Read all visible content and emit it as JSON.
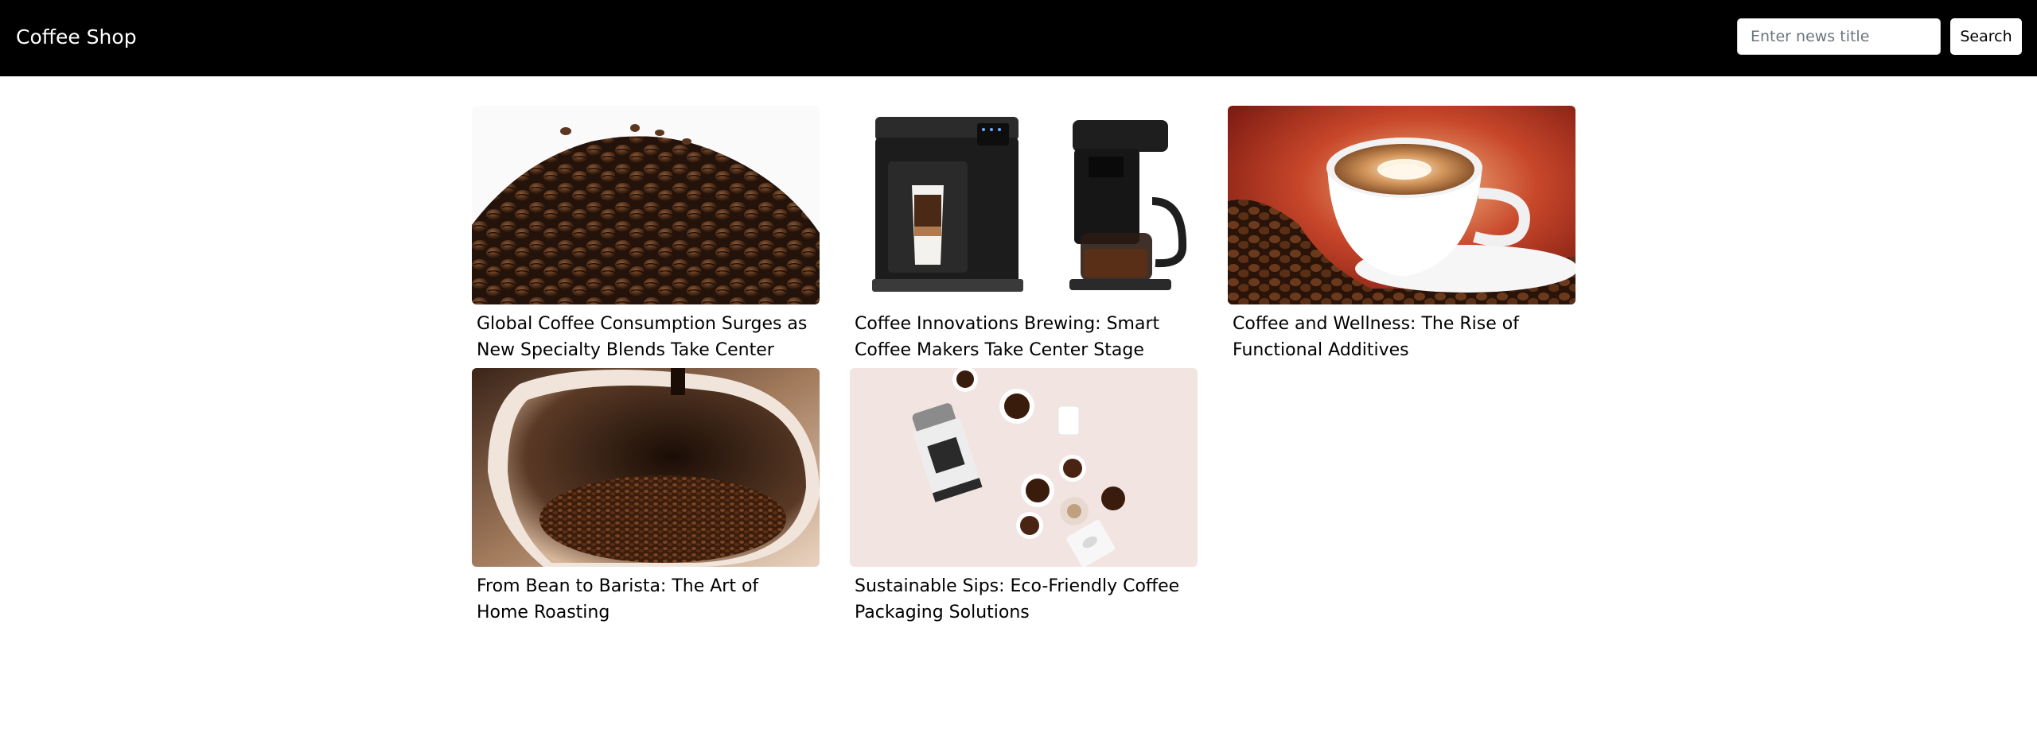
{
  "header": {
    "brand": "Coffee Shop",
    "search_placeholder": "Enter news title",
    "search_label": "Search"
  },
  "articles": [
    {
      "title": "Global Coffee Consumption Surges as New Specialty Blends Take Center Stage",
      "image": "coffee-beans-pile"
    },
    {
      "title": "Coffee Innovations Brewing: Smart Coffee Makers Take Center Stage",
      "image": "coffee-machines"
    },
    {
      "title": "Coffee and Wellness: The Rise of Functional Additives",
      "image": "latte-cup"
    },
    {
      "title": "From Bean to Barista: The Art of Home Roasting",
      "image": "roasting-bowl"
    },
    {
      "title": "Sustainable Sips: Eco-Friendly Coffee Packaging Solutions",
      "image": "eco-packaging"
    }
  ],
  "colors": {
    "header_bg": "#000000",
    "header_text": "#ffffff",
    "page_bg": "#ffffff"
  }
}
